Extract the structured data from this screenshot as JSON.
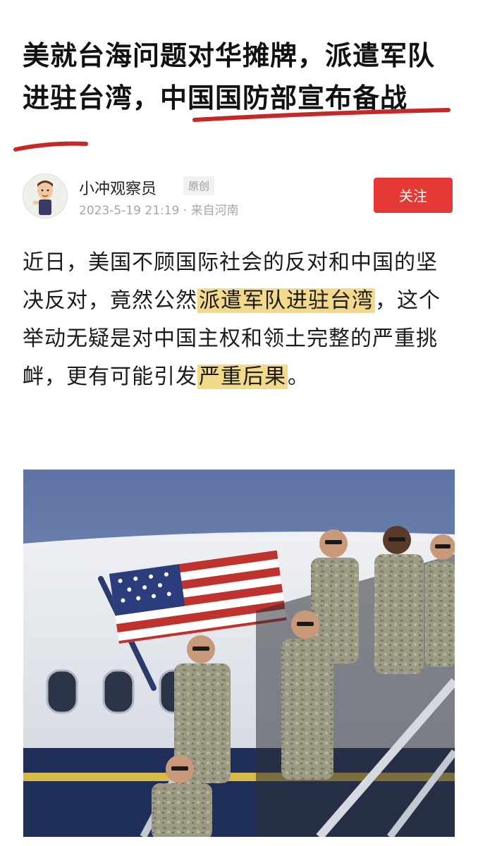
{
  "article": {
    "title": "美就台海问题对华摊牌，派遣军队进驻台湾，中国国防部宣布备战",
    "paragraph": {
      "p1": "近日，美国不顾国际社会的反对和中国的坚决反对，竟然公然",
      "h1": "派遣军队进驻台湾",
      "p2": "，这个举动无疑是对中国主权和领土完整的严重挑衅，更有可能引发",
      "h2": "严重后果",
      "p3": "。"
    }
  },
  "author": {
    "name": "小冲观察员",
    "tag": "原创",
    "meta": "2023-5-19 21:19 · 来自河南",
    "follow_label": "关注",
    "avatar_icon": "cartoon-man-avatar"
  },
  "photo": {
    "icon": "photo-soldiers-deplaning"
  },
  "colors": {
    "accent": "#e53935",
    "highlight": "#f3d98a",
    "underline": "#c62828"
  }
}
